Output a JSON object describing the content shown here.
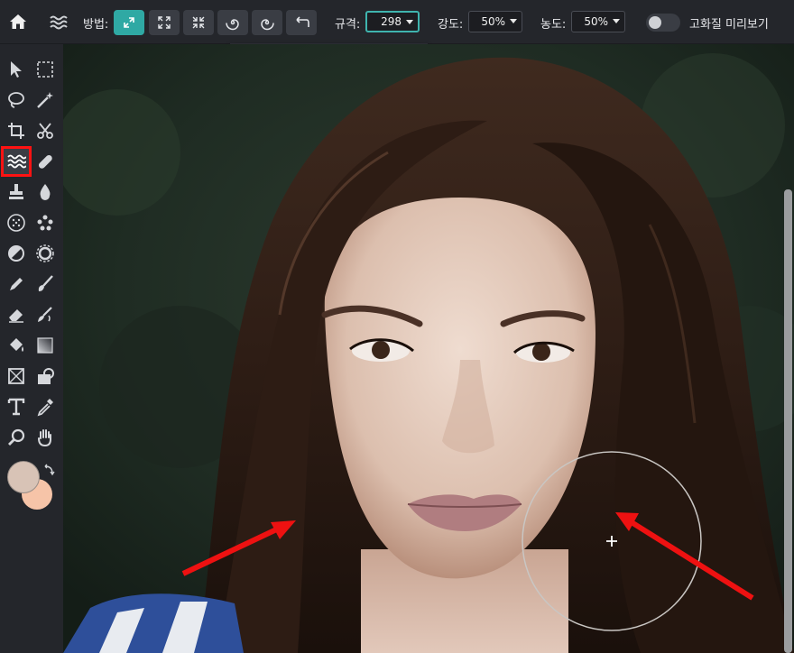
{
  "toolbar": {
    "home_icon": "home-icon",
    "tool_icon": "liquify-wave-icon",
    "method_label": "방법:",
    "methods": [
      {
        "icon": "expand-icon",
        "active": true
      },
      {
        "icon": "bloat-icon",
        "active": false
      },
      {
        "icon": "pinch-icon",
        "active": false
      },
      {
        "icon": "twirl-clockwise-icon",
        "active": false
      },
      {
        "icon": "twirl-counterclockwise-icon",
        "active": false
      },
      {
        "icon": "undo-icon",
        "active": false
      }
    ],
    "size_label": "규격:",
    "size_value": "298",
    "strength_label": "강도:",
    "strength_value": "50%",
    "density_label": "농도:",
    "density_value": "50%",
    "hq_preview_label": "고화질 미리보기",
    "hq_preview_on": false
  },
  "size_slider": {
    "level": 0.58
  },
  "tools": [
    "move-arrow-icon",
    "marquee-select-icon",
    "lasso-icon",
    "magic-wand-icon",
    "crop-icon",
    "scissors-icon",
    "liquify-wave-icon",
    "bandage-heal-icon",
    "stamp-icon",
    "blur-drop-icon",
    "sponge-dots-icon",
    "dots-cluster-icon",
    "dodge-burn-icon",
    "sharpen-gear-icon",
    "pen-icon",
    "brush-icon",
    "eraser-icon",
    "smudge-icon",
    "paint-bucket-icon",
    "gradient-icon",
    "shape-box-icon",
    "lock-shape-icon",
    "text-icon",
    "eyedropper-icon",
    "zoom-icon",
    "hand-icon"
  ],
  "selected_tool": "liquify-wave-icon",
  "colors": {
    "accent": "#2fa9a4",
    "primary_swatch": "#d8c3b6",
    "secondary_swatch": "#f6c4a8",
    "highlight": "#ff1212"
  }
}
